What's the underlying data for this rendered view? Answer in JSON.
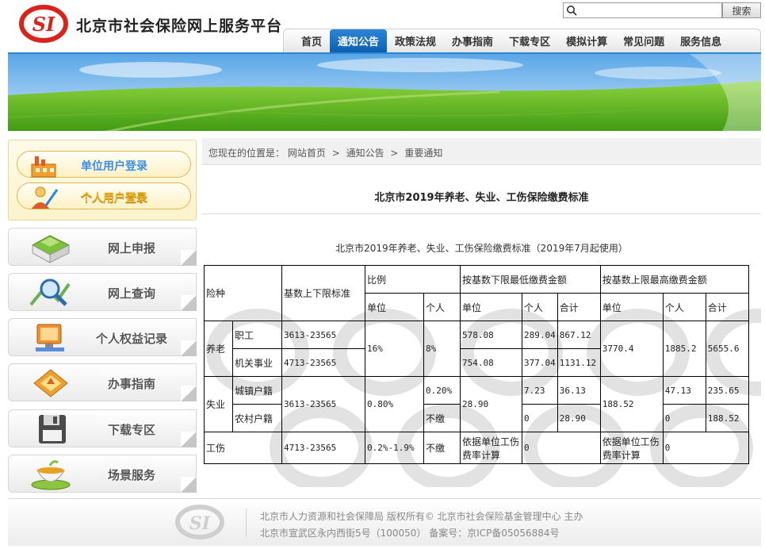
{
  "header": {
    "site_title": "北京市社会保险网上服务平台",
    "search_placeholder": "",
    "search_button": "搜索"
  },
  "nav": {
    "items": [
      {
        "label": "首页",
        "active": false
      },
      {
        "label": "通知公告",
        "active": true
      },
      {
        "label": "政策法规",
        "active": false
      },
      {
        "label": "办事指南",
        "active": false
      },
      {
        "label": "下载专区",
        "active": false
      },
      {
        "label": "模拟计算",
        "active": false
      },
      {
        "label": "常见问题",
        "active": false
      },
      {
        "label": "服务信息",
        "active": false
      }
    ]
  },
  "sidebar": {
    "unit_login": "单位用户登录",
    "personal_login": "个人用户登录",
    "menu": [
      {
        "label": "网上申报",
        "icon": "online-declaration-icon"
      },
      {
        "label": "网上查询",
        "icon": "magnifier-icon"
      },
      {
        "label": "个人权益记录",
        "icon": "computer-icon"
      },
      {
        "label": "办事指南",
        "icon": "guide-icon"
      },
      {
        "label": "下载专区",
        "icon": "floppy-disk-icon"
      },
      {
        "label": "场景服务",
        "icon": "tea-cup-icon"
      }
    ]
  },
  "breadcrumb": {
    "prefix": "您现在的位置是：",
    "items": [
      "网站首页",
      "通知公告",
      "重要通知"
    ],
    "separator": ">"
  },
  "article": {
    "title": "北京市2019年养老、失业、工伤保险缴费标准",
    "caption": "北京市2019年养老、失业、工伤保险缴费标准（2019年7月起使用）"
  },
  "table": {
    "h_type": "险种",
    "h_base": "基数上下限标准",
    "h_ratio": "比例",
    "h_min": "按基数下限最低缴费金额",
    "h_max": "按基数上限最高缴费金额",
    "h_unit": "单位",
    "h_person": "个人",
    "h_total": "合计",
    "pension": {
      "type": "养老",
      "ratio_unit": "16%",
      "ratio_person": "8%",
      "max_unit": "3770.4",
      "max_person": "1885.2",
      "max_total": "5655.6",
      "rows": [
        {
          "sub": "职工",
          "base": "3613-23565",
          "min_unit": "578.08",
          "min_person": "289.04",
          "min_total": "867.12"
        },
        {
          "sub": "机关事业",
          "base": "4713-23565",
          "min_unit": "754.08",
          "min_person": "377.04",
          "min_total": "1131.12"
        }
      ]
    },
    "unemployment": {
      "type": "失业",
      "base": "3613-23565",
      "ratio_unit": "0.80%",
      "min_unit": "28.90",
      "max_unit": "188.52",
      "rows": [
        {
          "sub": "城镇户籍",
          "ratio_person": "0.20%",
          "min_person": "7.23",
          "min_total": "36.13",
          "max_person": "47.13",
          "max_total": "235.65"
        },
        {
          "sub": "农村户籍",
          "ratio_person": "不缴",
          "min_person": "0",
          "min_total": "28.90",
          "max_person": "0",
          "max_total": "188.52"
        }
      ]
    },
    "injury": {
      "type": "工伤",
      "base": "4713-23565",
      "ratio_unit": "0.2%-1.9%",
      "ratio_person": "不缴",
      "min_unit": "依据单位工伤费率计算",
      "min_person": "0",
      "max_unit": "依据单位工伤费率计算",
      "max_person": "0"
    }
  },
  "footer": {
    "line1": "北京市人力资源和社会保障局 版权所有© 北京市社会保险基金管理中心 主办",
    "line2": "北京市宣武区永内西街5号（100050） 备案号：京ICP备05056884号"
  },
  "colors": {
    "nav_active": "#1a6fc4",
    "logo_red": "#d8241c",
    "unit_login_text": "#3b8ddc",
    "personal_login_text": "#f2b52a"
  }
}
